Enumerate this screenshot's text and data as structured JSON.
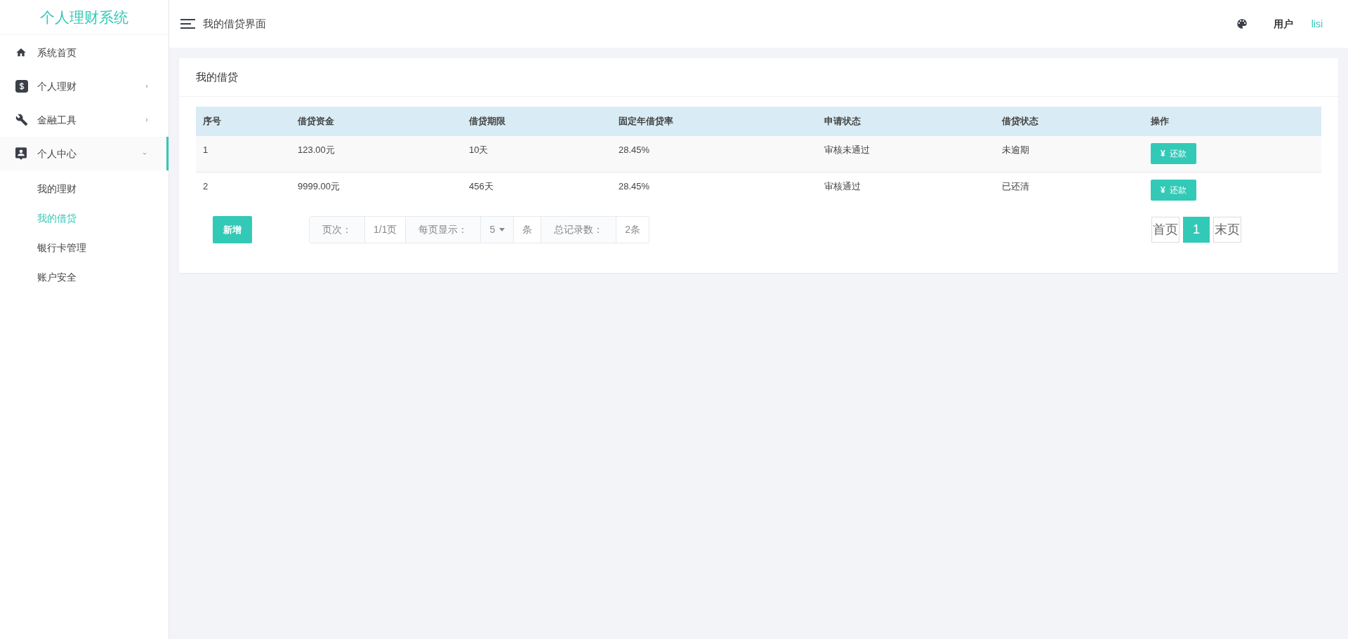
{
  "sidebar": {
    "title": "个人理财系统",
    "items": [
      {
        "kind": "link",
        "label": "系统首页",
        "expanded": false
      },
      {
        "kind": "group",
        "label": "个人理财",
        "expanded": false
      },
      {
        "kind": "group",
        "label": "金融工具",
        "expanded": false
      },
      {
        "kind": "group",
        "label": "个人中心",
        "expanded": true,
        "children": [
          {
            "label": "我的理财",
            "selected": false
          },
          {
            "label": "我的借贷",
            "selected": true
          },
          {
            "label": "银行卡管理",
            "selected": false
          },
          {
            "label": "账户安全",
            "selected": false
          }
        ]
      }
    ]
  },
  "header": {
    "title": "我的借贷界面",
    "user_label": "用户",
    "username": "lisi"
  },
  "card": {
    "title": "我的借贷",
    "table": {
      "columns": [
        "序号",
        "借贷资金",
        "借贷期限",
        "固定年借贷率",
        "申请状态",
        "借贷状态",
        "操作"
      ],
      "rows": [
        {
          "cells": [
            "1",
            "123.00元",
            "10天",
            "28.45%",
            "审核未通过",
            "未逾期"
          ],
          "action": {
            "icon_text": "¥",
            "label": "还款"
          }
        },
        {
          "cells": [
            "2",
            "9999.00元",
            "456天",
            "28.45%",
            "审核通过",
            "已还清"
          ],
          "action": {
            "icon_text": "¥",
            "label": "还款"
          }
        }
      ]
    },
    "add_button": "新增",
    "page_info": [
      {
        "kind": "label",
        "text": "页次："
      },
      {
        "kind": "value",
        "text": "1/1页"
      },
      {
        "kind": "label",
        "text": "每页显示："
      },
      {
        "kind": "select",
        "text": "5"
      },
      {
        "kind": "value",
        "text": "条"
      },
      {
        "kind": "label",
        "text": "总记录数："
      },
      {
        "kind": "value",
        "text": "2条"
      }
    ],
    "pager": [
      {
        "label": "首页",
        "selected": false
      },
      {
        "label": "1",
        "selected": true
      },
      {
        "label": "末页",
        "selected": false
      }
    ]
  }
}
